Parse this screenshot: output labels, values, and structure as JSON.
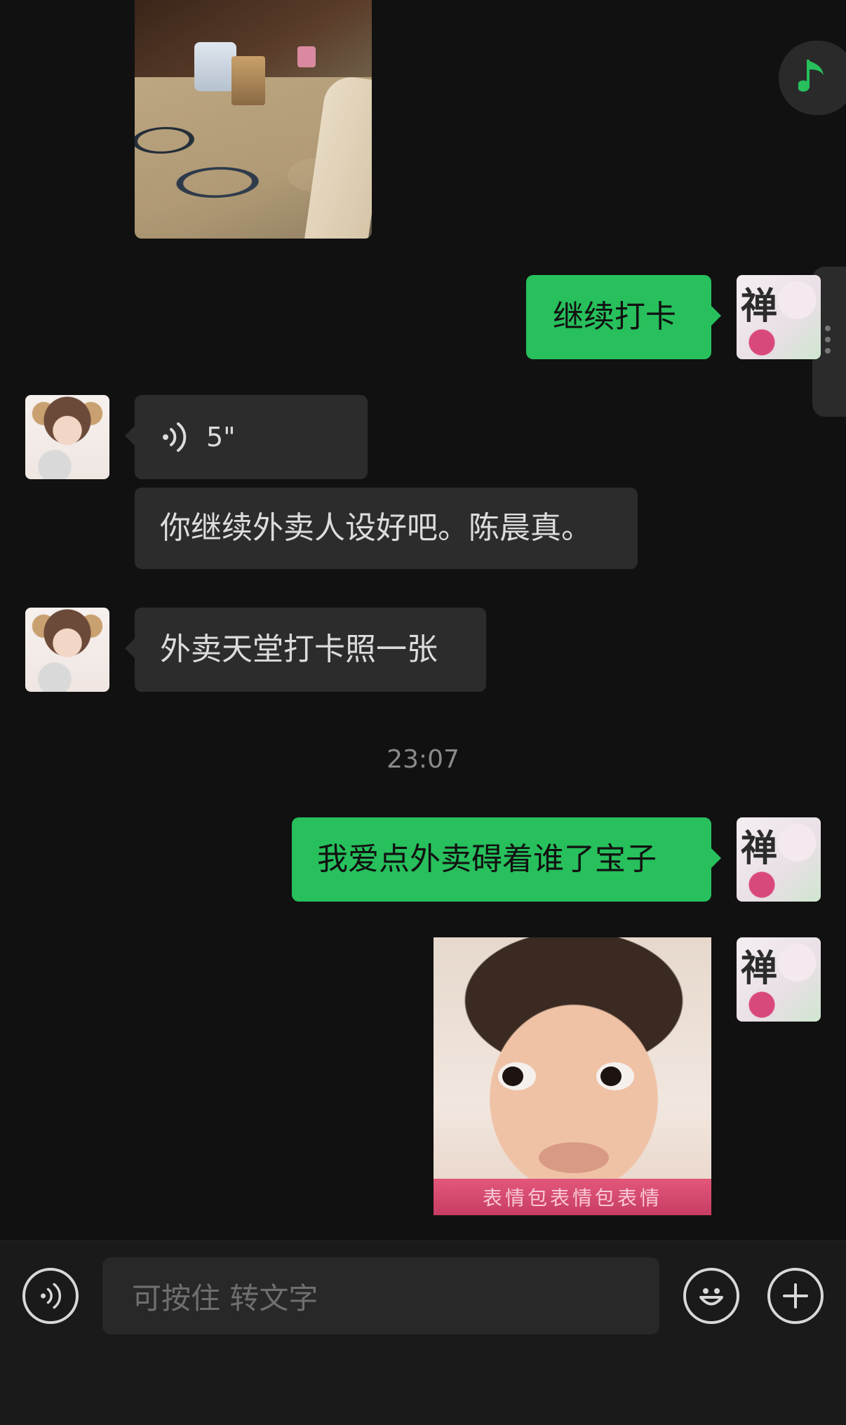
{
  "chat": {
    "messages": [
      {
        "id": "m1",
        "from": "other",
        "type": "image",
        "description": "photo"
      },
      {
        "id": "m2",
        "from": "self",
        "type": "text",
        "text": "继续打卡"
      },
      {
        "id": "m3",
        "from": "other",
        "type": "voice",
        "duration": "5\""
      },
      {
        "id": "m3t",
        "from": "other",
        "type": "transcription",
        "text": "你继续外卖人设好吧。陈晨真。"
      },
      {
        "id": "m4",
        "from": "other",
        "type": "text",
        "text": "外卖天堂打卡照一张"
      },
      {
        "id": "ts",
        "type": "timestamp",
        "text": "23:07"
      },
      {
        "id": "m5",
        "from": "self",
        "type": "text",
        "text": "我爱点外卖碍着谁了宝子"
      },
      {
        "id": "m6",
        "from": "self",
        "type": "sticker",
        "caption": "表情包表情包表情"
      }
    ],
    "self_avatar_glyph": "禅"
  },
  "floating": {
    "music_icon": "music-note-icon",
    "music_color": "#27c05c"
  },
  "input_bar": {
    "placeholder": "可按住 转文字",
    "voice_icon": "voice-icon",
    "emoji_icon": "emoji-icon",
    "plus_icon": "plus-icon"
  },
  "colors": {
    "background": "#111111",
    "bubble_out": "#27c05c",
    "bubble_in": "#2c2c2c"
  }
}
